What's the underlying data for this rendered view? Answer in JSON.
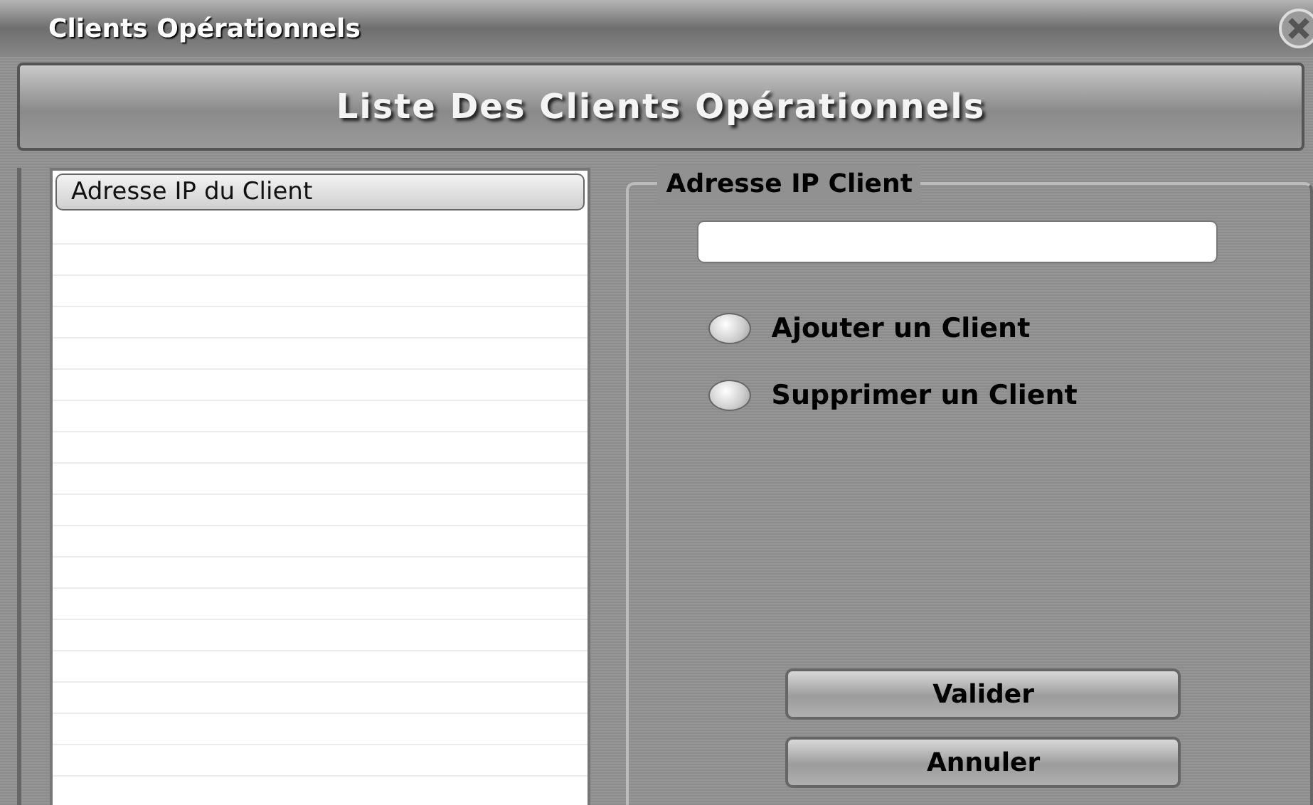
{
  "window": {
    "title": "Clients Opérationnels"
  },
  "banner": {
    "title": "Liste Des Clients Opérationnels"
  },
  "client_list": {
    "columns": [
      "Adresse IP du Client"
    ]
  },
  "ip_group": {
    "title": "Adresse IP Client",
    "options": [
      {
        "label": "Ajouter un Client",
        "selected": false
      },
      {
        "label": "Supprimer un Client",
        "selected": false
      }
    ],
    "buttons": [
      "Valider",
      "Annuler"
    ]
  }
}
